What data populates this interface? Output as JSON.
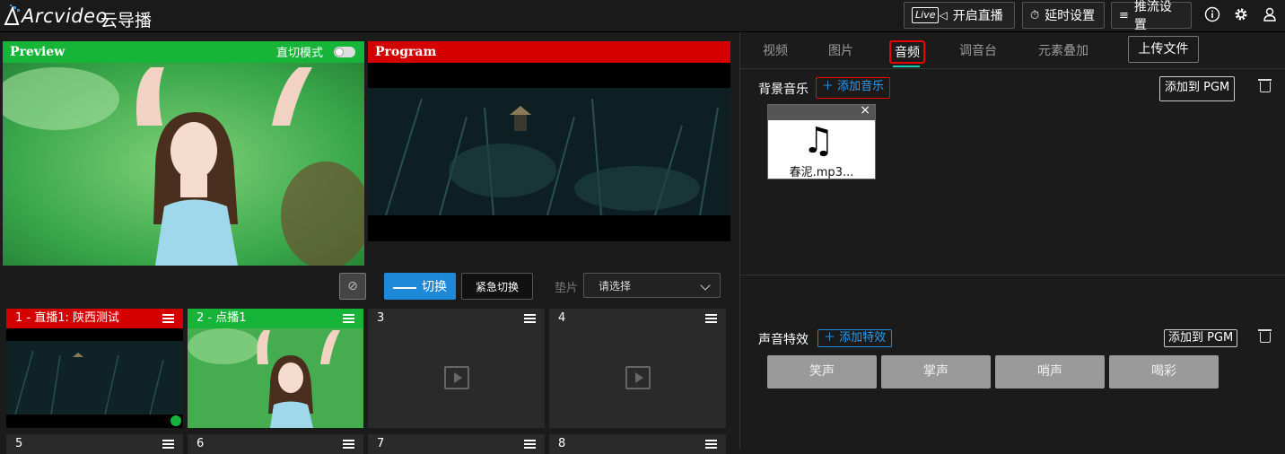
{
  "app": {
    "logo": "Arcvideo",
    "title": "云导播"
  },
  "topbar": {
    "live_badge": "Live",
    "start_live": "开启直播",
    "delay_settings": "延时设置",
    "stream_settings": "推流设置"
  },
  "preview": {
    "label": "Preview",
    "direct_mode_label": "直切模式"
  },
  "program": {
    "label": "Program"
  },
  "controls": {
    "switch_label": "切换",
    "emergency_switch_label": "紧急切换",
    "pad_label": "垫片",
    "pad_select_value": "请选择"
  },
  "sources": [
    {
      "label": "1 - 直播1: 陕西测试",
      "state": "program",
      "color": "#d40000"
    },
    {
      "label": "2 - 点播1",
      "state": "preview",
      "color": "#16b53a"
    },
    {
      "label": "3",
      "state": "empty"
    },
    {
      "label": "4",
      "state": "empty"
    },
    {
      "label": "5",
      "state": "empty"
    },
    {
      "label": "6",
      "state": "empty"
    },
    {
      "label": "7",
      "state": "empty"
    },
    {
      "label": "8",
      "state": "empty"
    }
  ],
  "right_panel": {
    "tabs": [
      "视频",
      "图片",
      "音频",
      "调音台",
      "元素叠加"
    ],
    "active_tab": "音频",
    "upload_button": "上传文件",
    "bg_music": {
      "label": "背景音乐",
      "add_button": "添加音乐",
      "add_to_pgm": "添加到 PGM",
      "files": [
        {
          "name": "春泥.mp3..."
        }
      ]
    },
    "sound_effects": {
      "label": "声音特效",
      "add_button": "添加特效",
      "add_to_pgm": "添加到 PGM",
      "items": [
        "笑声",
        "掌声",
        "哨声",
        "喝彩"
      ]
    }
  },
  "colors": {
    "preview_green": "#16b53a",
    "program_red": "#d40000",
    "accent_blue": "#1e88d9",
    "highlight_red": "#e00000"
  }
}
